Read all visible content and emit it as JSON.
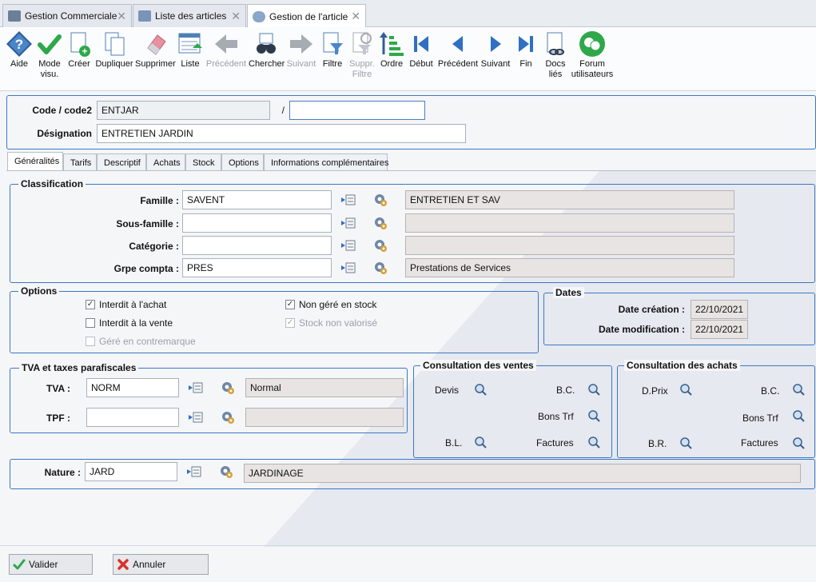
{
  "tabs": [
    {
      "label": "Gestion Commerciale",
      "close": "✕"
    },
    {
      "label": "Liste des articles",
      "close": "✕"
    },
    {
      "label": "Gestion de l'article",
      "close": "✕"
    }
  ],
  "toolbar": [
    {
      "label": "Aide",
      "icon": "help-icon"
    },
    {
      "label": "Mode visu.",
      "icon": "check-icon"
    },
    {
      "label": "Créer",
      "icon": "new-doc-icon"
    },
    {
      "label": "Dupliquer",
      "icon": "duplicate-icon"
    },
    {
      "label": "Supprimer",
      "icon": "eraser-icon"
    },
    {
      "label": "Liste",
      "icon": "list-icon"
    },
    {
      "label": "Précédent",
      "icon": "arrow-left-icon",
      "disabled": true
    },
    {
      "label": "Chercher",
      "icon": "binoculars-icon"
    },
    {
      "label": "Suivant",
      "icon": "arrow-right-icon",
      "disabled": true
    },
    {
      "label": "Filtre",
      "icon": "filter-icon"
    },
    {
      "label": "Suppr. Filtre",
      "icon": "remove-filter-icon",
      "disabled": true
    },
    {
      "label": "Ordre",
      "icon": "sort-icon"
    },
    {
      "label": "Début",
      "icon": "first-icon"
    },
    {
      "label": "Précédent",
      "icon": "prev-icon"
    },
    {
      "label": "Suivant",
      "icon": "next-icon"
    },
    {
      "label": "Fin",
      "icon": "last-icon"
    },
    {
      "label": "Docs liés",
      "icon": "linked-docs-icon"
    },
    {
      "label": "Forum utilisateurs",
      "icon": "forum-icon"
    }
  ],
  "header": {
    "code_label": "Code / code2",
    "code_value": "ENTJAR",
    "code_sep": "/",
    "code2_value": "",
    "designation_label": "Désignation",
    "designation_value": "ENTRETIEN JARDIN"
  },
  "subtabs": [
    "Généralités",
    "Tarifs",
    "Descriptif",
    "Achats",
    "Stock",
    "Options",
    "Informations complémentaires"
  ],
  "classification": {
    "title": "Classification",
    "rows": [
      {
        "label": "Famille :",
        "value": "SAVENT",
        "desc": "ENTRETIEN ET SAV"
      },
      {
        "label": "Sous-famille :",
        "value": "",
        "desc": ""
      },
      {
        "label": "Catégorie :",
        "value": "",
        "desc": ""
      },
      {
        "label": "Grpe compta :",
        "value": "PRES",
        "desc": "Prestations de Services"
      }
    ]
  },
  "options": {
    "title": "Options",
    "items": [
      {
        "label": "Interdit à l'achat",
        "checked": true,
        "disabled": false
      },
      {
        "label": "Interdit à la vente",
        "checked": false,
        "disabled": false
      },
      {
        "label": "Géré en contremarque",
        "checked": false,
        "disabled": true
      },
      {
        "label": "Non géré en stock",
        "checked": true,
        "disabled": false
      },
      {
        "label": "Stock non valorisé",
        "checked": true,
        "disabled": true
      }
    ]
  },
  "dates": {
    "title": "Dates",
    "creation_label": "Date création :",
    "creation_value": "22/10/2021",
    "modification_label": "Date modification :",
    "modification_value": "22/10/2021"
  },
  "tva": {
    "title": "TVA et taxes parafiscales",
    "tva_label": "TVA :",
    "tva_value": "NORM",
    "tva_desc": "Normal",
    "tpf_label": "TPF :",
    "tpf_value": "",
    "tpf_desc": ""
  },
  "ventes": {
    "title": "Consultation des ventes",
    "items": [
      "Devis",
      "B.C.",
      "Bons Trf",
      "B.L.",
      "Factures"
    ]
  },
  "achats": {
    "title": "Consultation des achats",
    "items": [
      "D.Prix",
      "B.C.",
      "Bons Trf",
      "B.R.",
      "Factures"
    ]
  },
  "nature": {
    "label": "Nature :",
    "value": "JARD",
    "desc": "JARDINAGE"
  },
  "buttons": {
    "validate": "Valider",
    "cancel": "Annuler"
  },
  "colors": {
    "accent": "#3b78c4",
    "green": "#2ea84a",
    "readonly": "#e8e4e4"
  }
}
